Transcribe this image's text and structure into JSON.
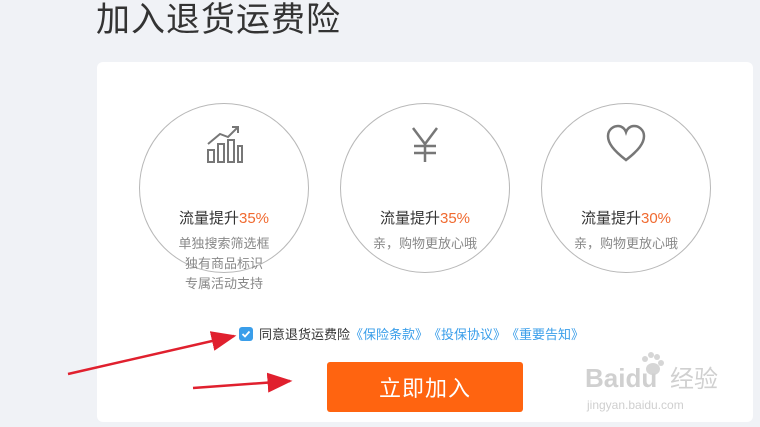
{
  "page": {
    "title": "加入退货运费险"
  },
  "benefits": [
    {
      "icon": "chart-up-icon",
      "headline_prefix": "流量提升",
      "percent": "35%",
      "desc": [
        "单独搜索筛选框",
        "独有商品标识",
        "专属活动支持"
      ]
    },
    {
      "icon": "yen-icon",
      "headline_prefix": "流量提升",
      "percent": "35%",
      "desc": [
        "亲，购物更放心哦"
      ]
    },
    {
      "icon": "heart-icon",
      "headline_prefix": "流量提升",
      "percent": "30%",
      "desc": [
        "亲，购物更放心哦"
      ]
    }
  ],
  "agreement": {
    "checked": true,
    "label": "同意退货运费险",
    "links": [
      "《保险条款》",
      "《投保协议》",
      "《重要告知》"
    ]
  },
  "join_button": {
    "label": "立即加入"
  },
  "watermark": {
    "brand": "Baidu",
    "brand_cn": "经验",
    "url": "jingyan.baidu.com"
  },
  "colors": {
    "accent": "#ff6410",
    "percent": "#f06a30",
    "link": "#3a9eea",
    "annotation_arrow": "#e0202e"
  }
}
